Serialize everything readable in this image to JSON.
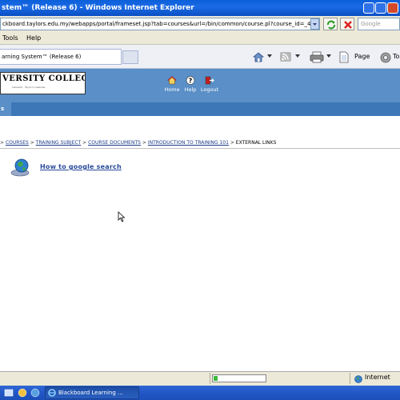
{
  "window": {
    "title": "stem™ (Release 6) - Windows Internet Explorer"
  },
  "address_bar": {
    "url": "ckboard.taylors.edu.my/webapps/portal/frameset.jsp?tab=courses&url=/bin/common/course.pl?course_id=_4",
    "search_placeholder": "Google"
  },
  "menu": {
    "items": [
      "Tools",
      "Help"
    ]
  },
  "tab": {
    "title": "arning System™ (Release 6)"
  },
  "command_bar": {
    "page_label": "Page",
    "tools_label": "To"
  },
  "header": {
    "logo_text": "VERSITY COLLEGE",
    "logo_sub": "Lakeside · Taylor's Lakeside",
    "nav": [
      {
        "label": "Home"
      },
      {
        "label": "Help"
      },
      {
        "label": "Logout"
      }
    ],
    "subtab": "s"
  },
  "breadcrumb": {
    "items": [
      "COURSES",
      "TRAINING SUBJECT",
      "COURSE DOCUMENTS",
      "INTRODUCTION TO TRAINING 101"
    ],
    "current": "EXTERNAL LINKS",
    "separator": ">"
  },
  "content": {
    "link_text": "How to google search"
  },
  "status": {
    "zone": "Internet",
    "progress": 0.08
  },
  "taskbar": {
    "window_button": "Blackboard Learning ..."
  },
  "colors": {
    "header_blue": "#5a8fc7",
    "subbar_blue": "#3d77b8",
    "link_blue": "#1a3a8a",
    "titlebar_blue": "#0b5fd8"
  }
}
